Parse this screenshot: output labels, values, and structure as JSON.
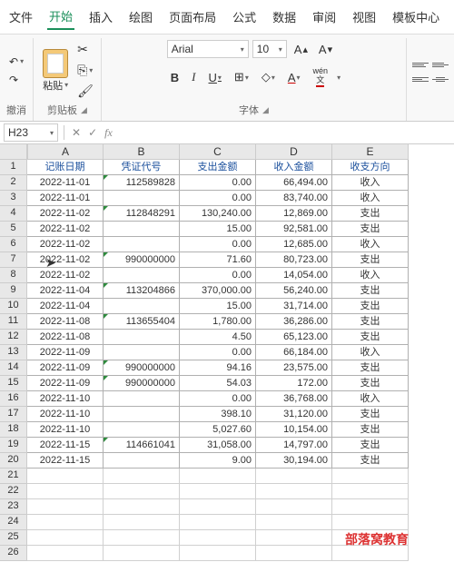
{
  "tabs": [
    "文件",
    "开始",
    "插入",
    "绘图",
    "页面布局",
    "公式",
    "数据",
    "审阅",
    "视图",
    "模板中心"
  ],
  "active_tab": 1,
  "groups": {
    "undo": "撤消",
    "clipboard": "剪贴板",
    "font": "字体"
  },
  "paste_label": "粘贴",
  "font": {
    "name": "Arial",
    "size": "10",
    "wen": "wén",
    "wenzi": "文"
  },
  "namebox": "H23",
  "fx": "fx",
  "col_headers": [
    "A",
    "B",
    "C",
    "D",
    "E"
  ],
  "row_headers": [
    "1",
    "2",
    "3",
    "4",
    "5",
    "6",
    "7",
    "8",
    "9",
    "10",
    "11",
    "12",
    "13",
    "14",
    "15",
    "16",
    "17",
    "18",
    "19",
    "20",
    "21",
    "22",
    "23",
    "24",
    "25",
    "26"
  ],
  "table_headers": [
    "记账日期",
    "凭证代号",
    "支出金额",
    "收入金额",
    "收支方向"
  ],
  "rows": [
    {
      "date": "2022-11-01",
      "voucher": "112589828",
      "t": true,
      "out": "0.00",
      "in": "66,494.00",
      "dir": "收入"
    },
    {
      "date": "2022-11-01",
      "voucher": "",
      "out": "0.00",
      "in": "83,740.00",
      "dir": "收入"
    },
    {
      "date": "2022-11-02",
      "voucher": "112848291",
      "t": true,
      "out": "130,240.00",
      "in": "12,869.00",
      "dir": "支出"
    },
    {
      "date": "2022-11-02",
      "voucher": "",
      "out": "15.00",
      "in": "92,581.00",
      "dir": "支出"
    },
    {
      "date": "2022-11-02",
      "voucher": "",
      "out": "0.00",
      "in": "12,685.00",
      "dir": "收入"
    },
    {
      "date": "2022-11-02",
      "voucher": "990000000",
      "t": true,
      "out": "71.60",
      "in": "80,723.00",
      "dir": "支出"
    },
    {
      "date": "2022-11-02",
      "voucher": "",
      "out": "0.00",
      "in": "14,054.00",
      "dir": "收入"
    },
    {
      "date": "2022-11-04",
      "voucher": "113204866",
      "t": true,
      "out": "370,000.00",
      "in": "56,240.00",
      "dir": "支出"
    },
    {
      "date": "2022-11-04",
      "voucher": "",
      "out": "15.00",
      "in": "31,714.00",
      "dir": "支出"
    },
    {
      "date": "2022-11-08",
      "voucher": "113655404",
      "t": true,
      "out": "1,780.00",
      "in": "36,286.00",
      "dir": "支出"
    },
    {
      "date": "2022-11-08",
      "voucher": "",
      "out": "4.50",
      "in": "65,123.00",
      "dir": "支出"
    },
    {
      "date": "2022-11-09",
      "voucher": "",
      "out": "0.00",
      "in": "66,184.00",
      "dir": "收入"
    },
    {
      "date": "2022-11-09",
      "voucher": "990000000",
      "t": true,
      "out": "94.16",
      "in": "23,575.00",
      "dir": "支出"
    },
    {
      "date": "2022-11-09",
      "voucher": "990000000",
      "t": true,
      "out": "54.03",
      "in": "172.00",
      "dir": "支出"
    },
    {
      "date": "2022-11-10",
      "voucher": "",
      "out": "0.00",
      "in": "36,768.00",
      "dir": "收入"
    },
    {
      "date": "2022-11-10",
      "voucher": "",
      "out": "398.10",
      "in": "31,120.00",
      "dir": "支出"
    },
    {
      "date": "2022-11-10",
      "voucher": "",
      "out": "5,027.60",
      "in": "10,154.00",
      "dir": "支出"
    },
    {
      "date": "2022-11-15",
      "voucher": "114661041",
      "t": true,
      "out": "31,058.00",
      "in": "14,797.00",
      "dir": "支出"
    },
    {
      "date": "2022-11-15",
      "voucher": "",
      "out": "9.00",
      "in": "30,194.00",
      "dir": "支出"
    }
  ],
  "watermark": "部落窝教育"
}
